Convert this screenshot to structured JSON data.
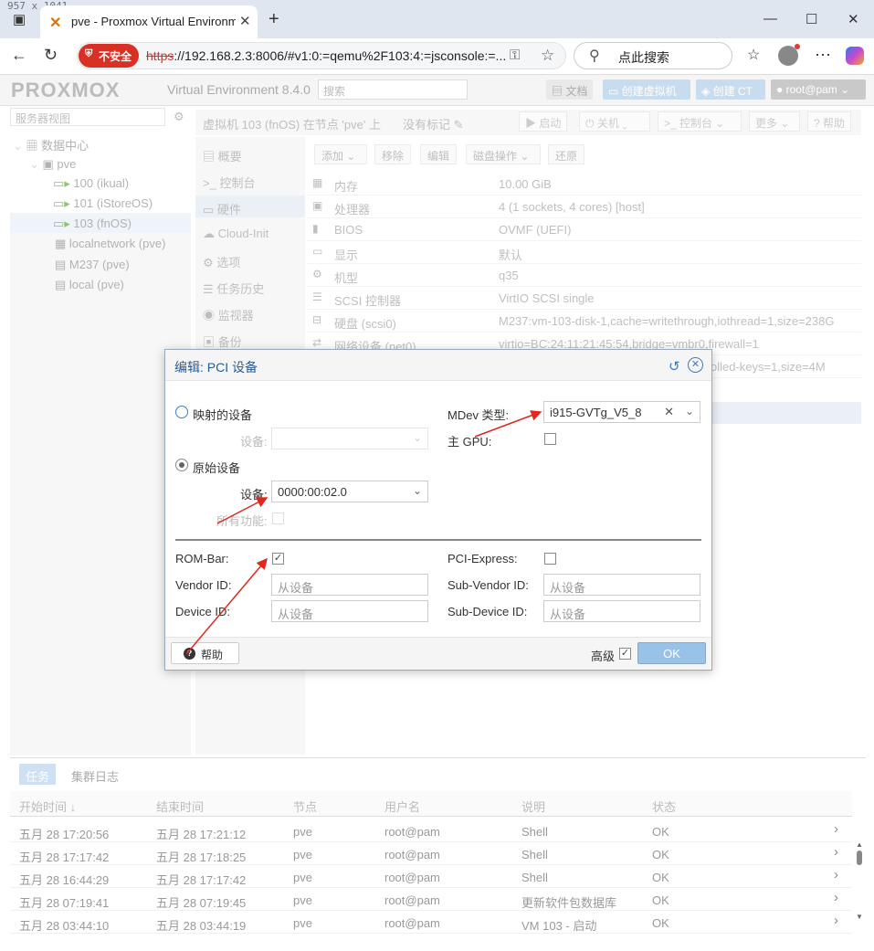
{
  "browser": {
    "dimensions_label": "957 x 1041",
    "tab_title": "pve - Proxmox Virtual Environment",
    "insecure_label": "不安全",
    "url_scheme": "https",
    "url_rest": "://192.168.2.3:8006/#v1:0:=qemu%2F103:4:=jsconsole:=...",
    "search_placeholder": "点此搜索"
  },
  "pve": {
    "logo": "PROXMOX",
    "version": "Virtual Environment 8.4.0",
    "search_placeholder": "搜索",
    "docs": "文档",
    "create_vm": "创建虚拟机",
    "create_ct": "创建 CT",
    "user": "root@pam"
  },
  "tree": {
    "view": "服务器视图",
    "items": [
      "数据中心",
      "pve",
      "100 (ikual)",
      "101 (iStoreOS)",
      "103 (fnOS)",
      "localnetwork (pve)",
      "M237 (pve)",
      "local (pve)"
    ]
  },
  "vm": {
    "title": "虚拟机 103 (fnOS) 在节点 'pve' 上",
    "tags": "没有标记",
    "start": "启动",
    "shutdown": "关机",
    "console": "控制台",
    "more": "更多",
    "help": "帮助"
  },
  "menu": [
    "概要",
    "控制台",
    "硬件",
    "Cloud-Init",
    "选项",
    "任务历史",
    "监视器",
    "备份"
  ],
  "toolbar": [
    "添加",
    "移除",
    "编辑",
    "磁盘操作",
    "还原"
  ],
  "hardware": [
    {
      "k": "内存",
      "v": "10.00 GiB"
    },
    {
      "k": "处理器",
      "v": "4 (1 sockets, 4 cores) [host]"
    },
    {
      "k": "BIOS",
      "v": "OVMF (UEFI)"
    },
    {
      "k": "显示",
      "v": "默认"
    },
    {
      "k": "机型",
      "v": "q35"
    },
    {
      "k": "SCSI 控制器",
      "v": "VirtIO SCSI single"
    },
    {
      "k": "硬盘 (scsi0)",
      "v": "M237:vm-103-disk-1,cache=writethrough,iothread=1,size=238G"
    },
    {
      "k": "网络设备 (net0)",
      "v": "virtio=BC:24:11:21:45:54,bridge=vmbr0,firewall=1"
    },
    {
      "k": "",
      "v": "olled-keys=1,size=4M"
    }
  ],
  "dialog": {
    "title": "编辑: PCI 设备",
    "mapped_device": "映射的设备",
    "device_label": "设备:",
    "raw_device": "原始设备",
    "raw_device_value": "0000:00:02.0",
    "all_functions": "所有功能:",
    "mdev_label": "MDev 类型:",
    "mdev_value": "i915-GVTg_V5_8",
    "primary_gpu": "主 GPU:",
    "rombar": "ROM-Bar:",
    "pcie": "PCI-Express:",
    "vendor_id": "Vendor ID:",
    "sub_vendor_id": "Sub-Vendor ID:",
    "device_id": "Device ID:",
    "sub_device_id": "Sub-Device ID:",
    "from_device": "从设备",
    "help": "帮助",
    "advanced": "高级",
    "ok": "OK"
  },
  "tasks": {
    "tab_tasks": "任务",
    "tab_cluster_log": "集群日志",
    "columns": [
      "开始时间 ↓",
      "结束时间",
      "节点",
      "用户名",
      "说明",
      "状态"
    ],
    "rows": [
      [
        "五月 28 17:20:56",
        "五月 28 17:21:12",
        "pve",
        "root@pam",
        "Shell",
        "OK"
      ],
      [
        "五月 28 17:17:42",
        "五月 28 17:18:25",
        "pve",
        "root@pam",
        "Shell",
        "OK"
      ],
      [
        "五月 28 16:44:29",
        "五月 28 17:17:42",
        "pve",
        "root@pam",
        "Shell",
        "OK"
      ],
      [
        "五月 28 07:19:41",
        "五月 28 07:19:45",
        "pve",
        "root@pam",
        "更新软件包数据库",
        "OK"
      ],
      [
        "五月 28 03:44:10",
        "五月 28 03:44:19",
        "pve",
        "root@pam",
        "VM 103 - 启动",
        "OK"
      ]
    ]
  },
  "colors": {
    "accent": "#2b5c8f",
    "ok_button": "#98c2e8",
    "insecure": "#d93025",
    "arrow": "#e0281e"
  }
}
